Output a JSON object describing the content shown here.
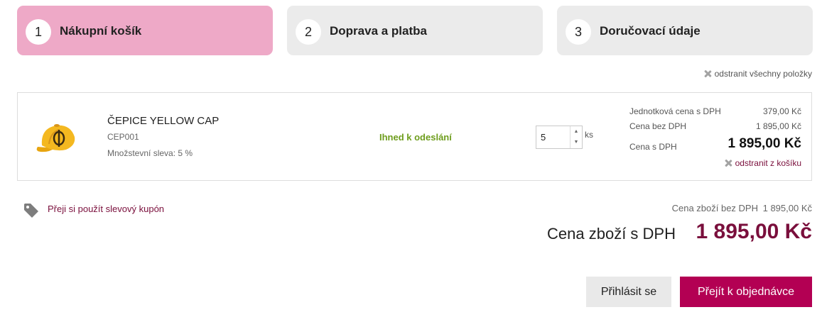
{
  "steps": [
    {
      "num": "1",
      "label": "Nákupní košík",
      "active": true
    },
    {
      "num": "2",
      "label": "Doprava a platba",
      "active": false
    },
    {
      "num": "3",
      "label": "Doručovací údaje",
      "active": false
    }
  ],
  "remove_all": "odstranit všechny položky",
  "item": {
    "name": "ČEPICE YELLOW CAP",
    "code": "CEP001",
    "discount": "Množstevní sleva: 5 %",
    "availability": "Ihned k odeslání",
    "quantity": "5",
    "unit": "ks",
    "unit_price_label": "Jednotková cena s DPH",
    "unit_price": "379,00 Kč",
    "price_without_vat_label": "Cena bez DPH",
    "price_without_vat": "1 895,00 Kč",
    "price_with_vat_label": "Cena s DPH",
    "price_with_vat": "1 895,00 Kč",
    "remove_label": "odstranit z košíku"
  },
  "coupon_link": "Přeji si použít slevový kupón",
  "summary": {
    "subtotal_label": "Cena zboží bez DPH",
    "subtotal": "1 895,00 Kč",
    "total_label": "Cena zboží s DPH",
    "total": "1 895,00 Kč"
  },
  "buttons": {
    "login": "Přihlásit se",
    "order": "Přejít k objednávce"
  },
  "colors": {
    "active_step": "#eea9c7",
    "inactive_step": "#ebebeb",
    "brand": "#b30053",
    "link": "#7a0f3c",
    "availability": "#6e9d1d"
  },
  "icons": [
    "close-icon",
    "tag-icon",
    "cap-product-image"
  ]
}
